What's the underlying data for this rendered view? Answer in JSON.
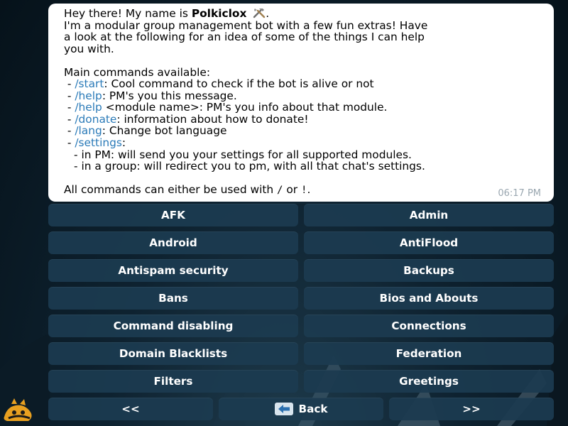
{
  "message": {
    "greeting_prefix": "Hey there! My name is ",
    "bot_name": "Polkiclox",
    "greeting_suffix": ".",
    "intro_line_1": "I'm a modular group management bot with a few fun extras! Have",
    "intro_line_2": "a look at the following for an idea of some of the things I can help",
    "intro_line_3": "you with.",
    "commands_heading": "Main commands available:",
    "commands": [
      {
        "bullet": " - ",
        "cmd": "/start",
        "desc": ": Cool command to check if the bot is alive or not"
      },
      {
        "bullet": " - ",
        "cmd": "/help",
        "desc": ": PM's you this message."
      },
      {
        "bullet": " - ",
        "cmd": "/help",
        "desc": " <module name>: PM's you info about that module."
      },
      {
        "bullet": " - ",
        "cmd": "/donate",
        "desc": ": information about how to donate!"
      },
      {
        "bullet": " - ",
        "cmd": "/lang",
        "desc": ": Change bot language"
      },
      {
        "bullet": " - ",
        "cmd": "/settings",
        "desc": ":"
      }
    ],
    "settings_sub": [
      "- in PM: will send you your settings for all supported modules.",
      "- in a group: will redirect you to pm, with all that chat's settings."
    ],
    "footer_prefix": "All commands can either be used with ",
    "footer_sym1": "/",
    "footer_or": " or ",
    "footer_sym2": "!",
    "footer_suffix": ".",
    "time": "06:17 PM"
  },
  "keyboard": {
    "rows": [
      [
        "AFK",
        "Admin"
      ],
      [
        "Android",
        "AntiFlood"
      ],
      [
        "Antispam security",
        "Backups"
      ],
      [
        "Bans",
        "Bios and Abouts"
      ],
      [
        "Command disabling",
        "Connections"
      ],
      [
        "Domain Blacklists",
        "Federation"
      ],
      [
        "Filters",
        "Greetings"
      ]
    ],
    "nav_prev": "<<",
    "nav_back": "Back",
    "nav_next": ">>"
  },
  "colors": {
    "link": "#2a7ab8",
    "button_bg": "#1c3a50",
    "bubble_bg": "#ffffff"
  },
  "icons": {
    "bot_name_emoji": "hammer-and-wrench-icon",
    "back_emoji": "back-arrow-icon",
    "avatar": "bot-avatar-icon"
  }
}
